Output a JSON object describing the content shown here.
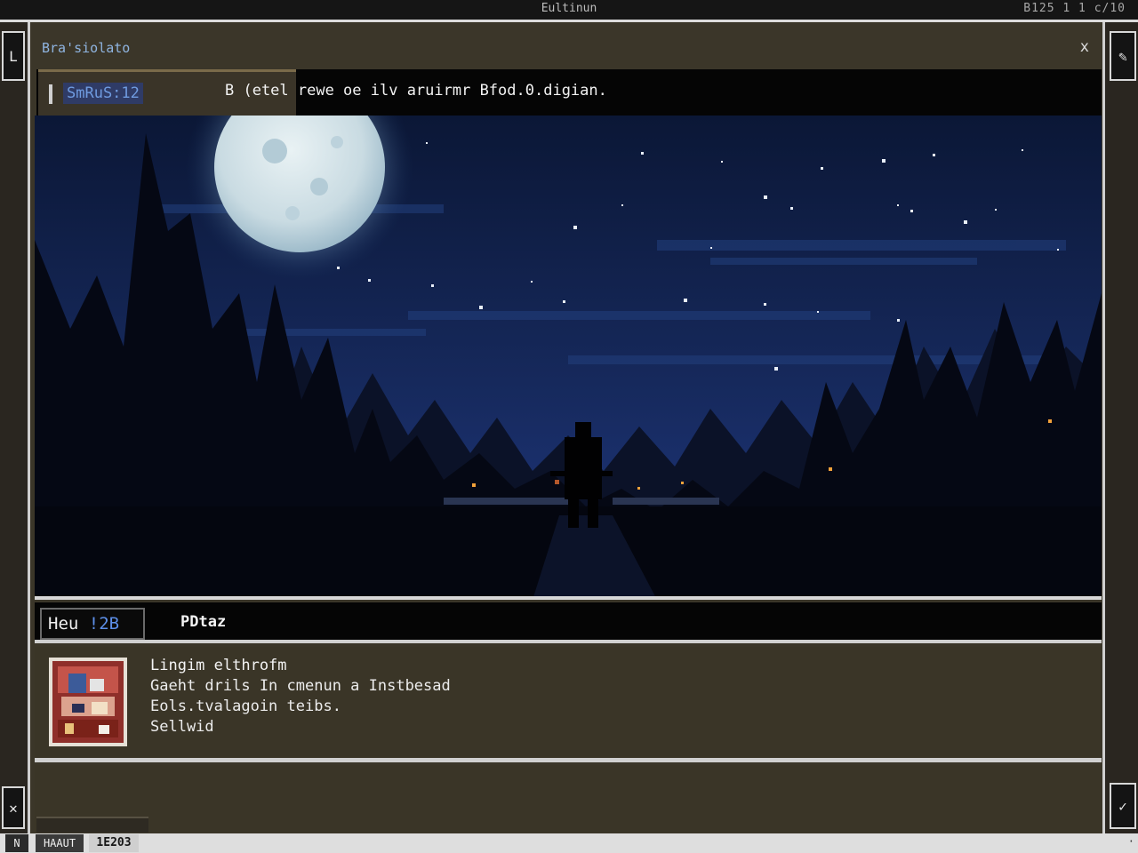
{
  "topbar": {
    "app_title": "Eultinun",
    "clock": "B125 1 1 c/10"
  },
  "window": {
    "title": "Bra'siolato",
    "close_glyph": "x"
  },
  "side": {
    "left_top_glyph": "L",
    "left_bottom_glyph": "✕",
    "right_top_glyph": "✎",
    "right_bottom_glyph": "✓"
  },
  "quest": {
    "tag": "SmRuS:12",
    "text": "B (etel rewe  oe ilv aruirmr Bfod.0.digian."
  },
  "status": {
    "hp_label": "Heu ",
    "hp_value": "!2B",
    "player_name": "PDtaz"
  },
  "dialog": {
    "speaker": "Lingim elthrofm",
    "line1": "Gaeht drils  In cmenun a Instbesad",
    "line2": "Eols.tvalagoin teibs.",
    "line3": "Sellwid"
  },
  "footer": {
    "icon_glyph": "N",
    "label": "HAAUT",
    "value": "1E203",
    "end_glyph": "·"
  },
  "colors": {
    "frame": "#3b3629",
    "sky_top": "#0c1a3c",
    "sky_bottom": "#1a2f66",
    "moon": "#d6e4ea",
    "hp_accent": "#5d8fe8"
  }
}
